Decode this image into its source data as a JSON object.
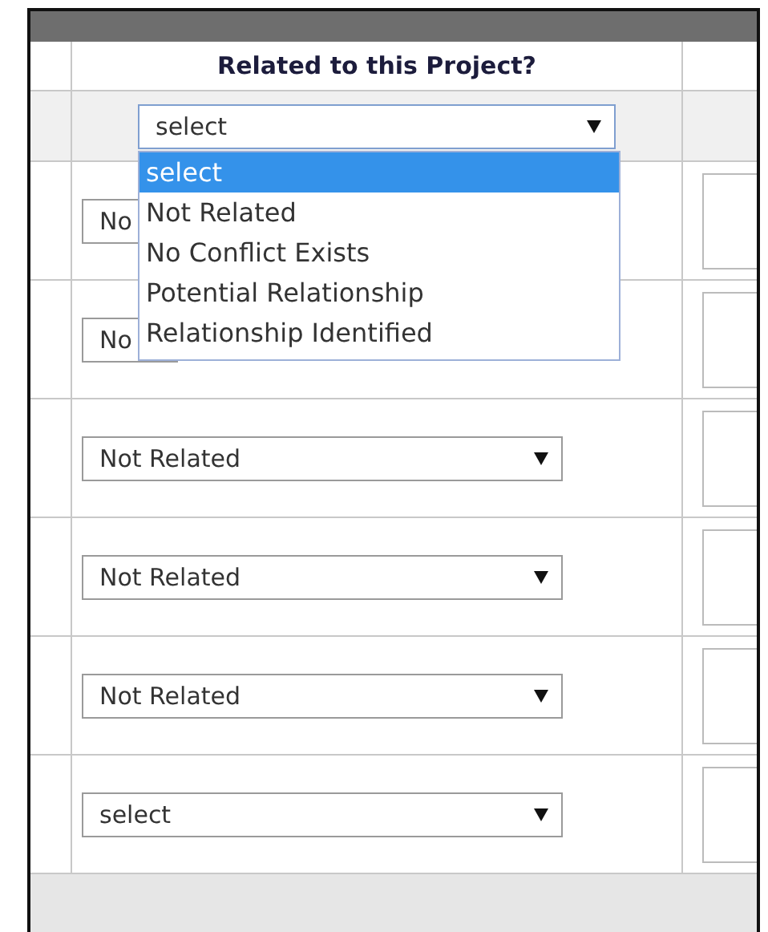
{
  "table": {
    "header": "Related to this Project?",
    "filter": {
      "value": "select",
      "expanded": true,
      "options": [
        {
          "label": "select",
          "selected": true
        },
        {
          "label": "Not Related",
          "selected": false
        },
        {
          "label": "No Conflict Exists",
          "selected": false
        },
        {
          "label": "Potential Relationship",
          "selected": false
        },
        {
          "label": "Relationship Identified",
          "selected": false
        }
      ]
    },
    "rows": [
      {
        "kind": "covered",
        "value": "No"
      },
      {
        "kind": "covered",
        "value": "No"
      },
      {
        "kind": "dropdown",
        "value": "Not Related"
      },
      {
        "kind": "dropdown",
        "value": "Not Related"
      },
      {
        "kind": "dropdown",
        "value": "Not Related"
      },
      {
        "kind": "dropdown",
        "value": "select"
      }
    ]
  }
}
